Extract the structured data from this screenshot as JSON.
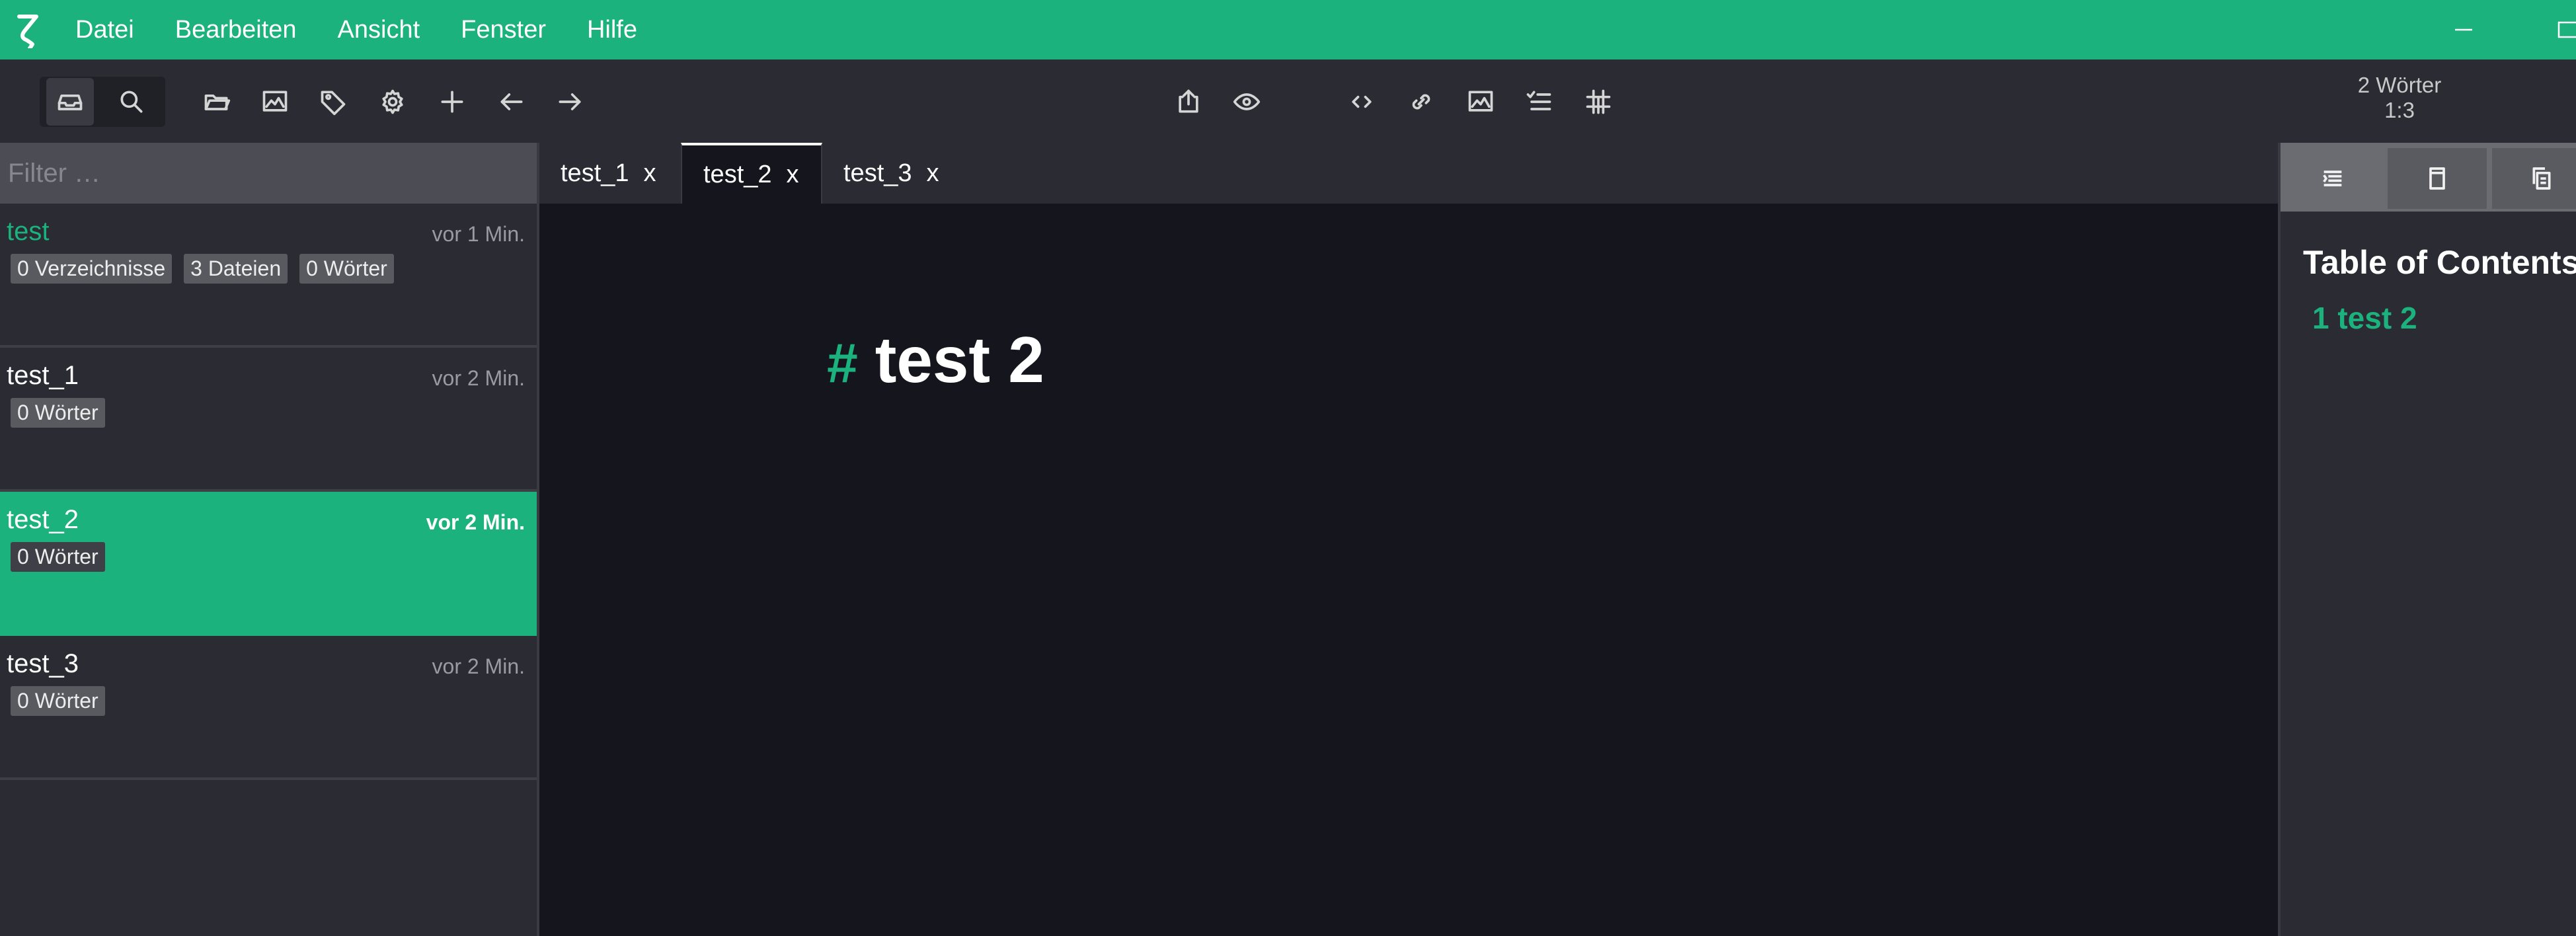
{
  "menu": {
    "items": [
      "Datei",
      "Bearbeiten",
      "Ansicht",
      "Fenster",
      "Hilfe"
    ]
  },
  "toolbar": {
    "word_count": "2 Wörter",
    "cursor_position": "1:3"
  },
  "sidebar": {
    "filter_placeholder": "Filter …",
    "items": [
      {
        "name": "test",
        "time": "vor 1 Min.",
        "badges": [
          "0 Verzeichnisse",
          "3 Dateien",
          "0 Wörter"
        ]
      },
      {
        "name": "test_1",
        "time": "vor 2 Min.",
        "badges": [
          "0 Wörter"
        ]
      },
      {
        "name": "test_2",
        "time": "vor 2 Min.",
        "badges": [
          "0 Wörter"
        ]
      },
      {
        "name": "test_3",
        "time": "vor 2 Min.",
        "badges": [
          "0 Wörter"
        ]
      }
    ]
  },
  "tabs": [
    {
      "label": "test_1",
      "close": "x"
    },
    {
      "label": "test_2",
      "close": "x"
    },
    {
      "label": "test_3",
      "close": "x"
    }
  ],
  "editor": {
    "heading_marker": "#",
    "heading_text": "test 2"
  },
  "right_panel": {
    "toc_title": "Table of Contents",
    "toc_entry": "1 test 2"
  },
  "colors": {
    "accent": "#1cb27e",
    "toolbar_bg": "#2b2b33",
    "editor_bg": "#15151e"
  }
}
